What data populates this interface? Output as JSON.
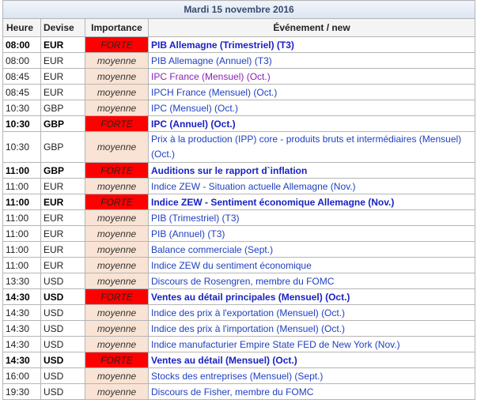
{
  "title": "Mardi 15 novembre 2016",
  "headers": {
    "time": "Heure",
    "currency": "Devise",
    "importance": "Importance",
    "event": "Événement / new"
  },
  "rows": [
    {
      "time": "08:00",
      "currency": "EUR",
      "importance": "FORTE",
      "event": "PIB Allemagne (Trimestriel) (T3)"
    },
    {
      "time": "08:00",
      "currency": "EUR",
      "importance": "moyenne",
      "event": "PIB Allemagne (Annuel) (T3)"
    },
    {
      "time": "08:45",
      "currency": "EUR",
      "importance": "moyenne",
      "event": "IPC France (Mensuel) (Oct.)"
    },
    {
      "time": "08:45",
      "currency": "EUR",
      "importance": "moyenne",
      "event": "IPCH France (Mensuel) (Oct.)"
    },
    {
      "time": "10:30",
      "currency": "GBP",
      "importance": "moyenne",
      "event": "IPC (Mensuel) (Oct.)"
    },
    {
      "time": "10:30",
      "currency": "GBP",
      "importance": "FORTE",
      "event": "IPC (Annuel) (Oct.)"
    },
    {
      "time": "10:30",
      "currency": "GBP",
      "importance": "moyenne",
      "event": "Prix à la production (IPP) core - produits bruts et intermédiaires (Mensuel) (Oct.)"
    },
    {
      "time": "11:00",
      "currency": "GBP",
      "importance": "FORTE",
      "event": "Auditions sur le rapport d`inflation"
    },
    {
      "time": "11:00",
      "currency": "EUR",
      "importance": "moyenne",
      "event": "Indice ZEW - Situation actuelle Allemagne (Nov.)"
    },
    {
      "time": "11:00",
      "currency": "EUR",
      "importance": "FORTE",
      "event": "Indice ZEW - Sentiment économique Allemagne (Nov.)"
    },
    {
      "time": "11:00",
      "currency": "EUR",
      "importance": "moyenne",
      "event": "PIB (Trimestriel) (T3)"
    },
    {
      "time": "11:00",
      "currency": "EUR",
      "importance": "moyenne",
      "event": "PIB (Annuel) (T3)"
    },
    {
      "time": "11:00",
      "currency": "EUR",
      "importance": "moyenne",
      "event": "Balance commerciale (Sept.)"
    },
    {
      "time": "11:00",
      "currency": "EUR",
      "importance": "moyenne",
      "event": "Indice ZEW du sentiment économique"
    },
    {
      "time": "13:30",
      "currency": "USD",
      "importance": "moyenne",
      "event": "Discours de Rosengren, membre du FOMC"
    },
    {
      "time": "14:30",
      "currency": "USD",
      "importance": "FORTE",
      "event": "Ventes au détail principales (Mensuel) (Oct.)"
    },
    {
      "time": "14:30",
      "currency": "USD",
      "importance": "moyenne",
      "event": "Indice des prix à l'exportation (Mensuel) (Oct.)"
    },
    {
      "time": "14:30",
      "currency": "USD",
      "importance": "moyenne",
      "event": "Indice des prix à l'importation (Mensuel) (Oct.)"
    },
    {
      "time": "14:30",
      "currency": "USD",
      "importance": "moyenne",
      "event": "Indice manufacturier Empire State FED de New York (Nov.)"
    },
    {
      "time": "14:30",
      "currency": "USD",
      "importance": "FORTE",
      "event": "Ventes au détail (Mensuel) (Oct.)"
    },
    {
      "time": "16:00",
      "currency": "USD",
      "importance": "moyenne",
      "event": "Stocks des entreprises (Mensuel) (Sept.)"
    },
    {
      "time": "19:30",
      "currency": "USD",
      "importance": "moyenne",
      "event": "Discours de Fisher, membre du FOMC"
    }
  ],
  "colors": {
    "forte": "#ff0000",
    "moyenne": "#f9e3d4",
    "event_link": "#2140c0",
    "event_purple": "#8a1fb8"
  }
}
